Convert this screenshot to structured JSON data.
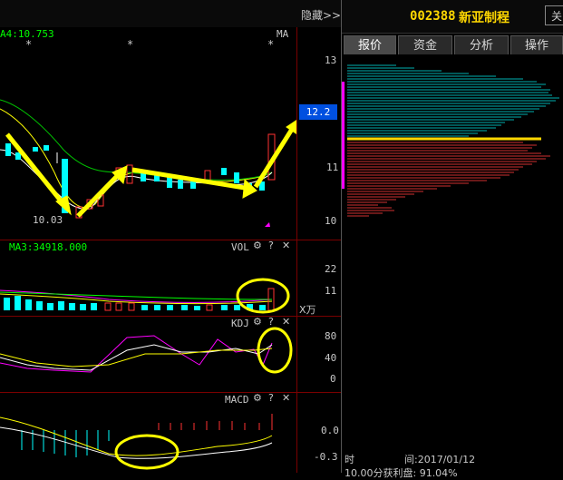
{
  "header": {
    "hide_label": "隐藏>>",
    "stock_code": "002388",
    "stock_name": "新亚制程",
    "corner_label": "关"
  },
  "main_chart": {
    "ma_label": "A4:10.753",
    "ma_button": "MA",
    "low_label": "10.03",
    "price_flag": "12.2",
    "price_axis": [
      "13",
      "12",
      "11",
      "10"
    ]
  },
  "vol": {
    "title": "MA3:34918.000",
    "name": "VOL",
    "axis": [
      "22",
      "11"
    ],
    "unit": "X万"
  },
  "kdj": {
    "name": "KDJ",
    "axis": [
      "80",
      "40",
      "0"
    ]
  },
  "macd": {
    "name": "MACD",
    "axis": [
      "0.0",
      "-0.3"
    ]
  },
  "tabs": [
    "报价",
    "资金",
    "分析",
    "操作"
  ],
  "info": {
    "time_label": "时",
    "date_label": "间:2017/01/12",
    "cut_line": "10.00分获利盘: 91.04%"
  },
  "colors": {
    "up": "#ff3232",
    "down": "#00ffff",
    "arrow": "#ffff00",
    "ma5": "#ffffff",
    "ma10": "#ffff00",
    "ma20": "#ff00ff",
    "ma60": "#00ff00"
  }
}
